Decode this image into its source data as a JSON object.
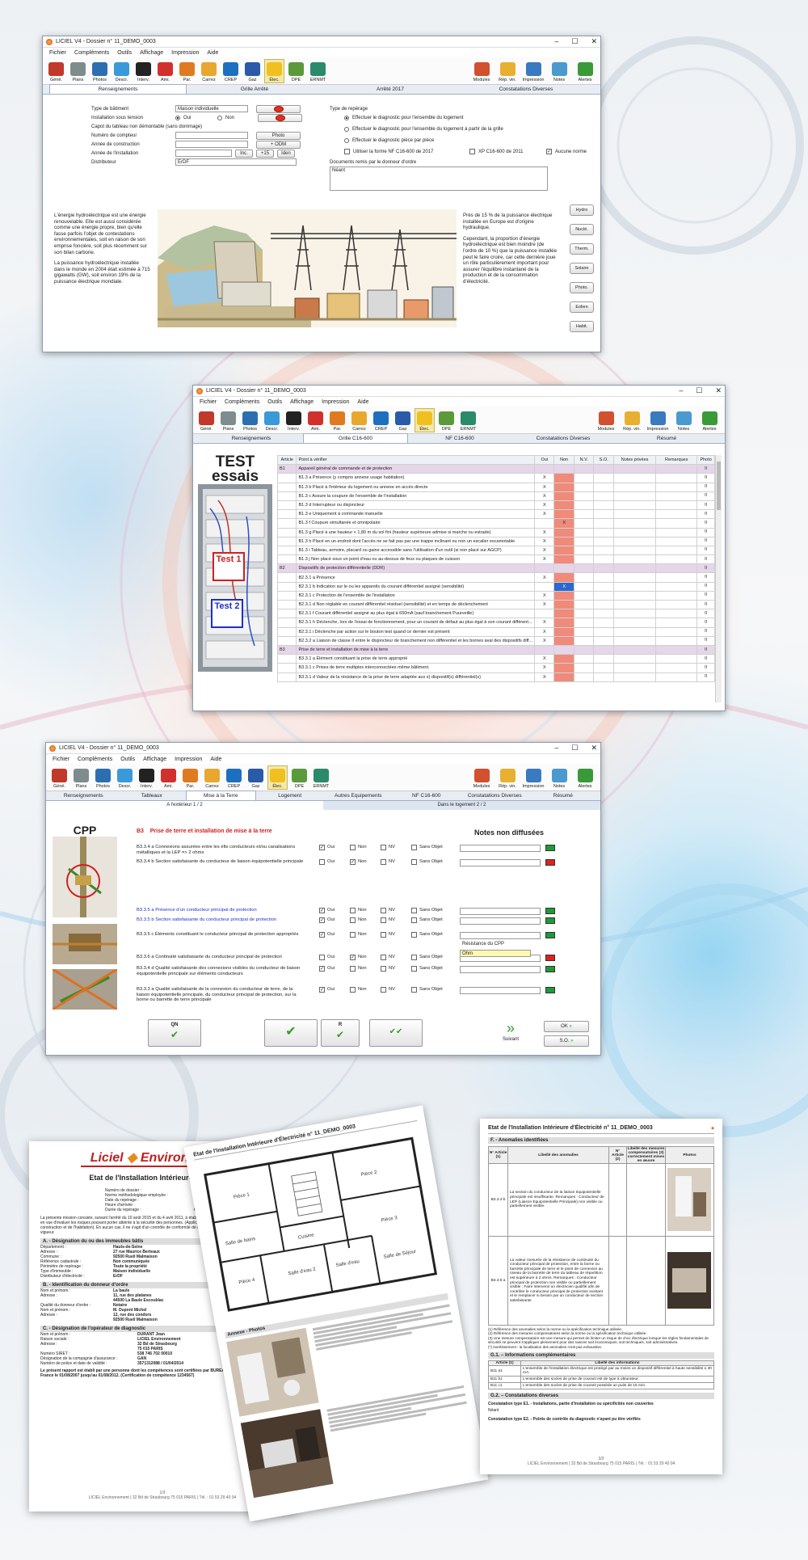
{
  "window1": {
    "title": "LICIEL V4 - Dossier n° 11_DEMO_0003",
    "menu": [
      "Fichier",
      "Compléments",
      "Outils",
      "Affichage",
      "Impression",
      "Aide"
    ],
    "toolbar": [
      "Géné.",
      "Plans",
      "Photos",
      "Descr.",
      "Interv.",
      "Ami.",
      "Par.",
      "Carrez",
      "CREP",
      "Gaz",
      "Élec.",
      "DPE",
      "ERNMT"
    ],
    "toolbar_right": [
      "Modules",
      "Rép. vin.",
      "Impression",
      "Notes",
      "Alertes"
    ],
    "tabs": [
      "Renseignements",
      "Grille Arrêté",
      "Arrêté 2017",
      "Constatations Diverses"
    ],
    "fields": {
      "type_batiment_label": "Type de bâtiment",
      "type_batiment_value": "Maison individuelle",
      "installation_label": "Installation sous tension",
      "oui": "Oui",
      "non": "Non",
      "capot_label": "Capot du tableau non démontable (sans dommage)",
      "compteur_label": "Numéro de compteur",
      "photo_btn": "Photo",
      "annee_construction_label": "Année de construction",
      "odm_btn": "+ ODM",
      "annee_installation_label": "Année de l'installation",
      "inc_btn": "Inc.",
      "plus15_btn": "+15",
      "iden_btn": "Iden",
      "distributeur_label": "Distributeur",
      "distributeur_value": "ErDF"
    },
    "reperage": {
      "title": "Type de repérage",
      "opt1": "Effectuer le diagnostic pour l'ensemble du logement",
      "opt2": "Effectuer le diagnostic pour l'ensemble du logement à partir de la grille",
      "opt3": "Effectuer le diagnostic pièce par pièce",
      "chk1": "Utiliser la forme NF C16-600 de 2017",
      "chk2": "XP C16-600 de 2011",
      "chk3": "Aucune norme",
      "docs_label": "Documents remis par le donneur d'ordre",
      "docs_value": "Néant"
    },
    "text_left": "L'énergie hydroélectrique est une énergie renouvelable. Elle est aussi considérée comme une énergie propre, bien qu'elle fasse parfois l'objet de contestations environnementales, soit en raison de son emprise foncière, soit plus récemment sur son bilan carbone.",
    "text_left2": "La puissance hydroélectrique installée dans le monde en 2004 était estimée à 715 gigawatts (GW), soit environ 19% de la puissance électrique mondiale.",
    "text_right": "Près de 15 % de la puissance électrique installée en Europe est d'origine hydraulique.",
    "text_right2": "Cependant, la proportion d'énergie hydroélectrique est bien moindre (de l'ordre de 10 %) que la puissance installée peut le faire croire, car cette dernière joue un rôle particulièrement important pour assurer l'équilibre instantané de la production et de la consommation d'électricité.",
    "side_buttons": [
      "Hydro",
      "Nuclé.",
      "Therm.",
      "Solaire",
      "Photo.",
      "Eolien",
      "Habit."
    ]
  },
  "window2": {
    "title": "LICIEL V4 - Dossier n° 11_DEMO_0003",
    "tabs": [
      "Renseignements",
      "Grille C16-600",
      "NF C16-600",
      "Constatations Diverses",
      "Résumé"
    ],
    "test_title": "TEST",
    "test_sub": "essais",
    "test1": "Test 1",
    "test2": "Test 2",
    "headers": [
      "Article",
      "Point à vérifier",
      "Oui",
      "Non",
      "N.V.",
      "S.O.",
      "Notes privées",
      "Remarques",
      "Photo"
    ],
    "rows": [
      {
        "a": "B1",
        "t": "Appareil général de commande et de protection",
        "sec": true
      },
      {
        "a": "",
        "t": "B1.3 a Présence (y compris annexe usage habitation)",
        "oui": "X"
      },
      {
        "a": "",
        "t": "B1.3 b Placé à l'intérieur du logement ou annexe en accès directe",
        "oui": "X"
      },
      {
        "a": "",
        "t": "B1.3 c Assure la coupure de l'ensemble de l'installation",
        "oui": "X"
      },
      {
        "a": "",
        "t": "B1.3 d Interrupteur ou disjoncteur",
        "oui": "X"
      },
      {
        "a": "",
        "t": "B1.3 e Uniquement à commande manuelle",
        "oui": "X"
      },
      {
        "a": "",
        "t": "B1.3 f Coupure simultanée et omnipolaire",
        "non": "X"
      },
      {
        "a": "",
        "t": "B1.3 g Placé à une hauteur < 1,80 m du sol fini (hauteur supérieure admise si marche ou estrade)",
        "oui": "X"
      },
      {
        "a": "",
        "t": "B1.3 h Placé en un endroit dont l'accès ne se fait pas par une trappe inclinant ou non un escalier escamotable",
        "oui": "X"
      },
      {
        "a": "",
        "t": "B1.3 i Tableau, armoire, placard ou gaine accessible sans l'utilisation d'un outil (si non placé sur AGCP)",
        "oui": "X"
      },
      {
        "a": "",
        "t": "B1.3 j Non placé sous un point d'eau ou au-dessus de feux ou plaques de cuisson",
        "oui": "X"
      },
      {
        "a": "B2",
        "t": "Dispositifs de protection différentielle (DDR)",
        "sec": true
      },
      {
        "a": "",
        "t": "B2.3.1 a Présence",
        "oui": "X"
      },
      {
        "a": "",
        "t": "B2.3.1 b Indication sur le ou les appareils du courant différentiel assigné (sensibilité)",
        "non": "X",
        "sel": true
      },
      {
        "a": "",
        "t": "B2.3.1 c Protection de l'ensemble de l'installation",
        "oui": "X"
      },
      {
        "a": "",
        "t": "B2.3.1 d Non réglable en courant différentiel résiduel (sensibilité) et en temps de déclenchement",
        "oui": "X"
      },
      {
        "a": "",
        "t": "B2.3.1 f Courant différentiel assigné au plus égal à 650mA (sauf branchement Puurveille)",
        "oui": ""
      },
      {
        "a": "",
        "t": "B2.3.1 h Déclenche, lors de l'essai de fonctionnement, pour un courant de défaut au plus égal à son courant différent...",
        "oui": "X"
      },
      {
        "a": "",
        "t": "B2.3.1 i Déclenche par action sur le bouton test quand ce dernier est présent",
        "oui": "X"
      },
      {
        "a": "",
        "t": "B2.3.2 a Liaison de classe II entre le disjoncteur de branchement non différentiel et les bornes aval des dispositifs diff...",
        "oui": "X"
      },
      {
        "a": "B3",
        "t": "Prise de terre et installation de mise à la terre",
        "sec": true
      },
      {
        "a": "",
        "t": "B3.3.1 a Élément constituant la prise de terre approprié",
        "oui": "X"
      },
      {
        "a": "",
        "t": "B3.3.1 c Prises de terre multiples interconnectées même bâtiment.",
        "oui": "X"
      },
      {
        "a": "",
        "t": "B3.3.1 d Valeur de la résistance de la prise de terre adaptée aux x) dispositif(s) différentiel(s)",
        "oui": "X"
      }
    ]
  },
  "window3": {
    "title": "LICIEL V4 - Dossier n° 11_DEMO_0003",
    "tabs": [
      "Renseignements",
      "Tableaux",
      "Mise à la Terre",
      "Logement",
      "Autres Equipements",
      "NF C16-600",
      "Constatations Diverses",
      "Résumé"
    ],
    "subtabs": [
      "A l'extérieur 1 / 2",
      "Dans le logement 2 / 2"
    ],
    "cpp": "CPP",
    "section_code": "B3",
    "section_title": "Prise de terre et installation de mise à la terre",
    "notes_title": "Notes non diffusées",
    "opts": [
      "Oui",
      "Non",
      "NV",
      "Sans Objet"
    ],
    "items": [
      {
        "t": "B3.3.4 a Connexions assurées entre les élts conducteurs et/ou canalisations métalliques et la LEP => 2 ohms",
        "c": 0,
        "flag": "green"
      },
      {
        "t": "B3.3.4 b Section satisfaisante du conducteur de liaison équipotentielle principale",
        "c": 1,
        "flag": "red"
      },
      {
        "t": "B3.3.5 a Présence d'un conducteur principal de protection",
        "c": 0,
        "flag": "green",
        "blue": true
      },
      {
        "t": "B3.3.5 b Section satisfaisante du conducteur principal de protection",
        "c": 0,
        "flag": "green",
        "blue": true
      },
      {
        "t": "B3.3.5 c Éléments constituant le conducteur principal de protection appropriés",
        "c": 0,
        "flag": "green"
      },
      {
        "t": "B3.3.6 a Continuité satisfaisante du conducteur principal de protection",
        "c": 1,
        "flag": "red"
      },
      {
        "t": "B3.3.4 d Qualité satisfaisante des connexions visibles du conducteur de liaison équipotentielle principale sur éléments conducteurs",
        "c": 0,
        "flag": "green"
      },
      {
        "t": "B3.3.3 a Qualité satisfaisante de la connexion du conducteur de terre, de la liaison équipotentielle principale, du conducteur principal de protection, sur la borne ou barrette de terre principale",
        "c": 0,
        "flag": "green"
      }
    ],
    "resistance_label": "Résistance du CPP",
    "resistance_value": "Ohm",
    "bottom": {
      "suivant": "Suivant",
      "ok": "OK",
      "so": "S.O.",
      "qn": "QN",
      "r": "R"
    }
  },
  "docs": {
    "brand1": "Liciel",
    "brand2": "Environnement",
    "doc1_title": "Etat de l'Installation Intérieure d'Électricité",
    "doc1_fields": [
      [
        "Numéro de dossier :",
        "11_DEMO_0003"
      ],
      [
        "Norme méthodologique employée :",
        "AFNOR FD C"
      ],
      [
        "Date du repérage :",
        "23/07/2012"
      ],
      [
        "Heure d'arrivée :",
        "11 h 59"
      ],
      [
        "Durée du repérage :",
        "02 h 35"
      ]
    ],
    "doc1_intro": "La présente mission consiste, suivant l'arrêté du 10 août 2015 et du 4 avril 2011, à établir un état de l'installation intérieure d'électricité, en vue d'évaluer les risques pouvant porter atteinte à la sécurité des personnes. (Application de l'article L.134-7 du code de la construction et de l'habitation). En aucun cas, il ne s'agit d'un contrôle de conformité de l'installation vis-à-vis de la réglementation en vigueur.",
    "secA": "A. - Désignation du ou des immeubles bâtis",
    "secA_rows": [
      [
        "Département :",
        "Hauts-de-Seine"
      ],
      [
        "Adresse :",
        "27 rue Maurice Berteaux"
      ],
      [
        "Commune :",
        "92500 Rueil Malmaison"
      ],
      [
        "Référence cadastrale :",
        "Non communiquée"
      ],
      [
        "Périmètre de repérage :",
        "Toute la propriété"
      ],
      [
        "Type d'immeuble :",
        "Maison individuelle"
      ],
      [
        "Distributeur d'électricité :",
        "ErDF"
      ]
    ],
    "secB": "B. - Identification du donneur d'ordre",
    "secB_rows": [
      [
        "Nom et prénom :",
        "La baule"
      ],
      [
        "Adresse :",
        "11, rue des platanes"
      ],
      [
        "",
        "44500 La Baule Escoublac"
      ],
      [
        "Qualité du donneur d'ordre :",
        "Notaire"
      ],
      [
        "Nom et prénom :",
        "M. Dupont Michel"
      ],
      [
        "Adresse :",
        "12, rue des condors"
      ],
      [
        "",
        "92500 Rueil Malmaison"
      ]
    ],
    "secC": "C. - Désignation de l'opérateur de diagnostic",
    "secC_rows": [
      [
        "Nom et prénom :",
        "DURANT Jean"
      ],
      [
        "Raison sociale :",
        "LICIEL Environnement"
      ],
      [
        "Adresse :",
        "32 Bd de Strasbourg"
      ],
      [
        "",
        "75 015 PARIS"
      ],
      [
        "Numéro SIRET :",
        "538 746 702 00010"
      ],
      [
        "Désignation de la compagnie d'assurance :",
        "GAN"
      ],
      [
        "Numéro de police et date de validité :",
        "3571312088 / 01/04/2014"
      ]
    ],
    "doc1_cert": "Le présent rapport est établi par une personne dont les compétences sont certifiées par BUREAU VERITAS CERTIFICATION France le 01/08/2007 jusqu'au 01/08/2012. (Certification de compétence 1234567)",
    "doc1_page": "1/3",
    "doc2_title": "Etat de l'Installation Intérieure d'Électricité n° 11_DEMO_0003",
    "doc2_rooms": [
      "Pièce 1",
      "Pièce 2",
      "Pièce 3",
      "Pièce 4",
      "Cuisine",
      "Salle de bains",
      "Salle d'eau",
      "Salle de Séjour",
      "Salle d'eau 2"
    ],
    "doc2_annexe": "Annexe - Photos",
    "doc3_title": "Etat de l'Installation Intérieure d'Électricité n° 11_DEMO_0003",
    "doc3_secF": "F. - Anomalies identifiées",
    "doc3_heads": [
      "N° Article (1)",
      "Libellé des anomalies",
      "N° Article (2)",
      "Libellé des mesures compensatoires (3) correctement mises en œuvre",
      "Photos"
    ],
    "doc3_rows": [
      {
        "a": "B3.3.4 b",
        "t": "La section du conducteur de la liaison équipotentielle principale est insuffisante. Remarques : Conducteur de LEP (Liaison Equipotentielle Principale) non visible ou partiellement visible."
      },
      {
        "a": "B3.3.5 a",
        "t": "La valeur mesurée de la résistance de continuité du conducteur principal de protection, entre la borne ou barrette principale de terre et le point de connexion au niveau de la barrette de terre du tableau de répartition est supérieure à 2 ohms. Remarques : Conducteur principal de protection non visible ou partiellement visible ; Faire intervenir un électricien qualifié afin de contrôler le conducteur principal de protection existant et le remplacer si besoin par un conducteur de section satisfaisante"
      }
    ],
    "doc3_notes": [
      "(1) Référence des anomalies selon la norme ou la spécification technique utilisée.",
      "(2) Référence des mesures compensatoires selon la norme ou la spécification technique utilisée.",
      "(3) Une mesure compensatoire est une mesure qui permet de limiter un risque de choc électrique lorsque les règles fondamentales de sécurité ne peuvent s'appliquer pleinement pour des raisons soit économiques, soit techniques, soit administratives.",
      "(*) Avertissement : la localisation des anomalies n'est pas exhaustive."
    ],
    "doc3_secG1": "G.1. – Informations complémentaires",
    "doc3_g1_heads": [
      "Article (1)",
      "Libellé des informations"
    ],
    "doc3_g1_rows": [
      [
        "B11 a1",
        "L'ensemble de l'installation électrique est protégé par au moins un dispositif différentiel à haute sensibilité ≤ 30 mA."
      ],
      [
        "B11 b1",
        "L'ensemble des socles de prise de courant est de type à obturateur."
      ],
      [
        "B11 c1",
        "L'ensemble des socles de prise de courant possède un puits de 15 mm."
      ]
    ],
    "doc3_secG2": "G.2. – Constatations diverses",
    "doc3_const1": "Constatation type E1. - Installations, partie d'installation ou spécificités non couvertes",
    "doc3_const1_val": "Néant",
    "doc3_const2": "Constatation type E2. - Points de contrôle du diagnostic n'ayant pu être vérifiés",
    "doc3_page": "3/3",
    "doc_footer": "LICIEL Environnement | 32 Bd de Strasbourg 75 015 PARIS | Tél. : 01 53 29 40 04"
  }
}
